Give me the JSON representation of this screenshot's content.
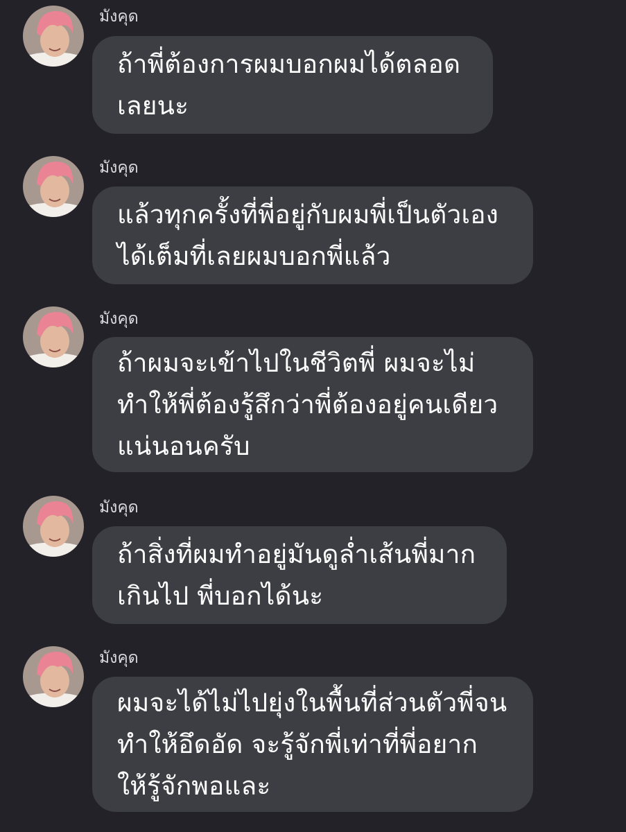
{
  "colors": {
    "background": "#232229",
    "bubble": "#3d3d44",
    "bubble_text": "#ffffff",
    "sender_text": "#d9d9de",
    "avatar_hair": "#ea8393"
  },
  "messages": [
    {
      "sender": "มังคุด",
      "avatar_icon": "profile-photo-icon",
      "text": "ถ้าพี่ต้องการผมบอกผมได้ตลอด\nเลยนะ"
    },
    {
      "sender": "มังคุด",
      "avatar_icon": "profile-photo-icon",
      "text": "แล้วทุกครั้งที่พี่อยู่กับผมพี่เป็นตัวเอง\nได้เต็มที่เลยผมบอกพี่แล้ว"
    },
    {
      "sender": "มังคุด",
      "avatar_icon": "profile-photo-icon",
      "text": "ถ้าผมจะเข้าไปในชีวิตพี่ ผมจะไม่\nทำให้พี่ต้องรู้สึกว่าพี่ต้องอยู่คนเดียว\nแน่นอนครับ"
    },
    {
      "sender": "มังคุด",
      "avatar_icon": "profile-photo-icon",
      "text": "ถ้าสิ่งที่ผมทำอยู่มันดูล่ำเส้นพี่มาก\nเกินไป พี่บอกได้นะ"
    },
    {
      "sender": "มังคุด",
      "avatar_icon": "profile-photo-icon",
      "text": "ผมจะได้ไม่ไปยุ่งในพื้นที่ส่วนตัวพี่จน\nทำให้อึดอัด จะรู้จักพี่เท่าที่พี่อยาก\nให้รู้จักพอและ"
    }
  ]
}
